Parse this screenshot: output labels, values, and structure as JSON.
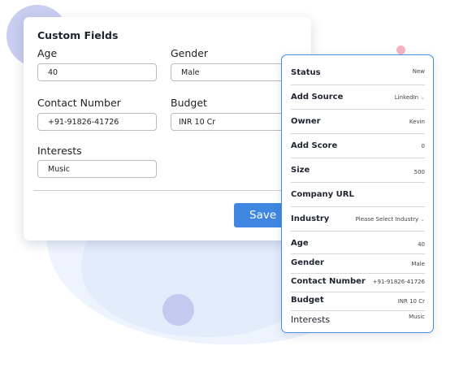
{
  "custom_fields": {
    "title": "Custom Fields",
    "age": {
      "label": "Age",
      "value": "40"
    },
    "gender": {
      "label": "Gender",
      "value": "Male"
    },
    "contact_number": {
      "label": "Contact Number",
      "value": "+91-91826-41726"
    },
    "budget": {
      "label": "Budget",
      "value": "INR 10 Cr"
    },
    "interests": {
      "label": "Interests",
      "value": "Music"
    },
    "save_label": "Save"
  },
  "details_panel": {
    "rows": [
      {
        "label": "Status",
        "value": "New"
      },
      {
        "label": "Add Source",
        "value": "LinkedIn",
        "dropdown": true
      },
      {
        "label": "Owner",
        "value": "Kevin"
      },
      {
        "label": "Add Score",
        "value": "0"
      },
      {
        "label": "Size",
        "value": "500"
      },
      {
        "label": "Company URL",
        "value": ""
      },
      {
        "label": "Industry",
        "value": "Please Select Industry",
        "dropdown": true
      },
      {
        "label": "Age",
        "value": "40"
      },
      {
        "label": "Gender",
        "value": "Male"
      },
      {
        "label": "Contact Number",
        "value": "+91-91826-41726"
      },
      {
        "label": "Budget",
        "value": "INR 10 Cr"
      },
      {
        "label": "Interests",
        "value": "Music"
      }
    ]
  },
  "colors": {
    "accent": "#3f87e0",
    "panel_border": "#4a8de0",
    "blob_light": "#eef4fd",
    "blob_mid": "#e2ecfb",
    "circle_lavender": "#c9cdf0",
    "dot_pink": "#f4b4bf"
  },
  "icons": {
    "dropdown": "chevron-down-icon"
  }
}
